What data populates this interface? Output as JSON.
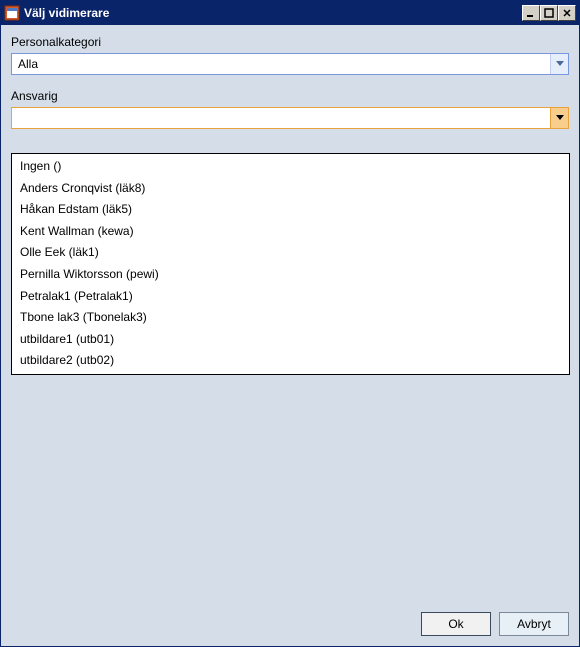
{
  "window": {
    "title": "Välj vidimerare"
  },
  "fields": {
    "category_label": "Personalkategori",
    "category_value": "Alla",
    "responsible_label": "Ansvarig",
    "responsible_value": ""
  },
  "dropdown": {
    "items": [
      "Ingen ()",
      "Anders Cronqvist (läk8)",
      "Håkan Edstam (läk5)",
      "Kent Wallman (kewa)",
      "Olle Eek (läk1)",
      "Pernilla Wiktorsson (pewi)",
      "Petralak1 (Petralak1)",
      "Tbone lak3 (Tbonelak3)",
      "utbildare1 (utb01)",
      "utbildare2 (utb02)"
    ]
  },
  "buttons": {
    "ok": "Ok",
    "cancel": "Avbryt"
  }
}
